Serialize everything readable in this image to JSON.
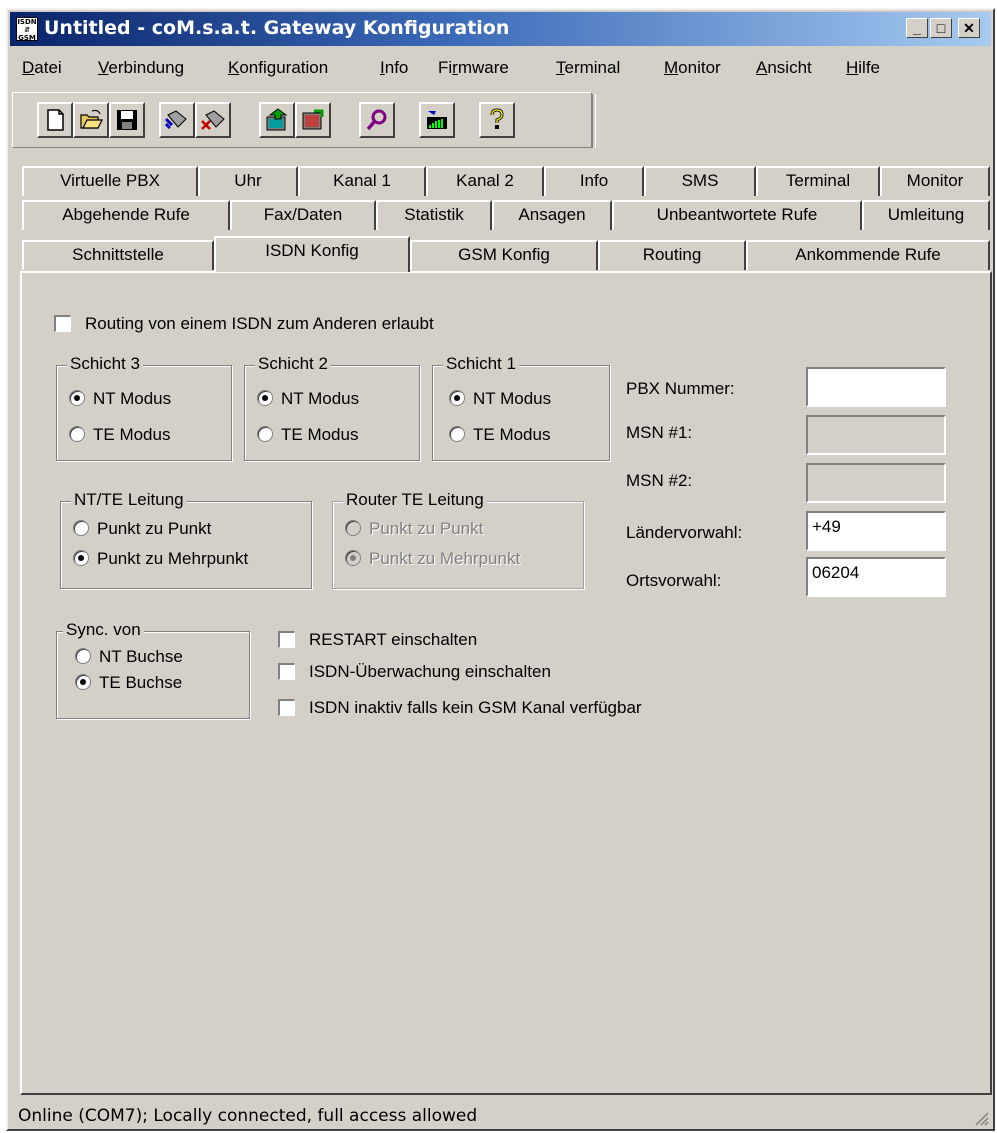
{
  "window": {
    "app_icon_text": "ISDN GSM",
    "title": "Untitled - coM.s.a.t. Gateway Konfiguration"
  },
  "menu": [
    {
      "pre": "",
      "u": "D",
      "post": "atei"
    },
    {
      "pre": "",
      "u": "V",
      "post": "erbindung"
    },
    {
      "pre": "",
      "u": "K",
      "post": "onfiguration"
    },
    {
      "pre": "",
      "u": "I",
      "post": "nfo"
    },
    {
      "pre": "Fi",
      "u": "r",
      "post": "mware"
    },
    {
      "pre": "",
      "u": "T",
      "post": "erminal"
    },
    {
      "pre": "",
      "u": "M",
      "post": "onitor"
    },
    {
      "pre": "",
      "u": "A",
      "post": "nsicht"
    },
    {
      "pre": "",
      "u": "H",
      "post": "ilfe"
    }
  ],
  "toolbar": [
    "new-icon",
    "open-icon",
    "save-icon",
    "connect-icon",
    "disconnect-icon",
    "upload-icon",
    "download-icon",
    "search-icon",
    "signal-icon",
    "help-icon"
  ],
  "tabs": {
    "row1": [
      "Virtuelle PBX",
      "Uhr",
      "Kanal 1",
      "Kanal 2",
      "Info",
      "SMS",
      "Terminal",
      "Monitor"
    ],
    "row2": [
      "Abgehende Rufe",
      "Fax/Daten",
      "Statistik",
      "Ansagen",
      "Unbeantwortete Rufe",
      "Umleitung"
    ],
    "row3": [
      "Schnittstelle",
      "ISDN Konfig",
      "GSM Konfig",
      "Routing",
      "Ankommende Rufe"
    ],
    "active": "ISDN Konfig"
  },
  "routing_checkbox": {
    "label": "Routing von einem ISDN zum Anderen erlaubt",
    "checked": false
  },
  "schicht3": {
    "title": "Schicht 3",
    "options": [
      "NT Modus",
      "TE Modus"
    ],
    "selected": "NT Modus"
  },
  "schicht2": {
    "title": "Schicht 2",
    "options": [
      "NT Modus",
      "TE Modus"
    ],
    "selected": "NT Modus"
  },
  "schicht1": {
    "title": "Schicht 1",
    "options": [
      "NT Modus",
      "TE Modus"
    ],
    "selected": "NT Modus"
  },
  "ntte": {
    "title": "NT/TE Leitung",
    "options": [
      "Punkt zu Punkt",
      "Punkt zu Mehrpunkt"
    ],
    "selected": "Punkt zu Mehrpunkt"
  },
  "router": {
    "title": "Router TE Leitung",
    "options": [
      "Punkt zu Punkt",
      "Punkt zu Mehrpunkt"
    ],
    "selected": "Punkt zu Mehrpunkt",
    "enabled": false
  },
  "sync": {
    "title": "Sync. von",
    "options": [
      "NT Buchse",
      "TE Buchse"
    ],
    "selected": "TE Buchse"
  },
  "checks": [
    {
      "label": "RESTART einschalten",
      "checked": false
    },
    {
      "label": "ISDN-Überwachung einschalten",
      "checked": false
    },
    {
      "label": "ISDN inaktiv falls kein GSM Kanal verfügbar",
      "checked": false
    }
  ],
  "fields": {
    "pbx_label": "PBX Nummer:",
    "pbx_value": "",
    "msn1_label": "MSN #1:",
    "msn1_value": "",
    "msn2_label": "MSN #2:",
    "msn2_value": "",
    "land_label": "Ländervorwahl:",
    "land_value": "+49",
    "orts_label": "Ortsvorwahl:",
    "orts_value": "06204"
  },
  "status": "Online (COM7); Locally connected, full access allowed"
}
